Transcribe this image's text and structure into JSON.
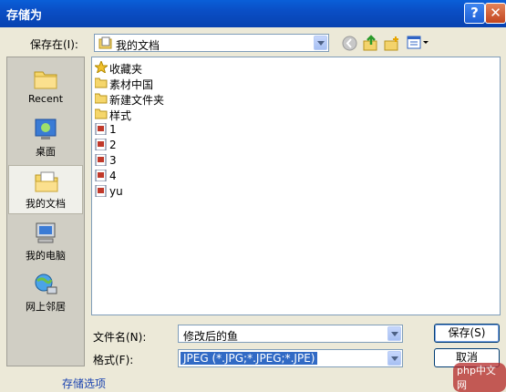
{
  "window": {
    "title": "存储为",
    "help_glyph": "?",
    "close_glyph": "✕"
  },
  "save_in": {
    "label": "保存在(I):",
    "value": "我的文档"
  },
  "places": [
    {
      "label": "Recent",
      "icon": "recent-folder-icon"
    },
    {
      "label": "桌面",
      "icon": "desktop-icon"
    },
    {
      "label": "我的文档",
      "icon": "my-documents-icon",
      "selected": true
    },
    {
      "label": "我的电脑",
      "icon": "my-computer-icon"
    },
    {
      "label": "网上邻居",
      "icon": "network-icon"
    }
  ],
  "files": [
    {
      "name": "收藏夹",
      "type": "favorites"
    },
    {
      "name": "素材中国",
      "type": "folder"
    },
    {
      "name": "新建文件夹",
      "type": "folder"
    },
    {
      "name": "样式",
      "type": "folder"
    },
    {
      "name": "1",
      "type": "psd"
    },
    {
      "name": "2",
      "type": "psd"
    },
    {
      "name": "3",
      "type": "psd"
    },
    {
      "name": "4",
      "type": "psd"
    },
    {
      "name": "yu",
      "type": "psd"
    }
  ],
  "filename": {
    "label": "文件名(N):",
    "value": "修改后的鱼"
  },
  "format": {
    "label": "格式(F):",
    "value": "JPEG (*.JPG;*.JPEG;*.JPE)"
  },
  "buttons": {
    "save": "保存(S)",
    "cancel": "取消"
  },
  "more_options": "存储选项",
  "watermark": "php中文网",
  "colors": {
    "title_bar": "#0a4ec5",
    "dialog_bg": "#ece9d8",
    "selection": "#316ac5"
  }
}
